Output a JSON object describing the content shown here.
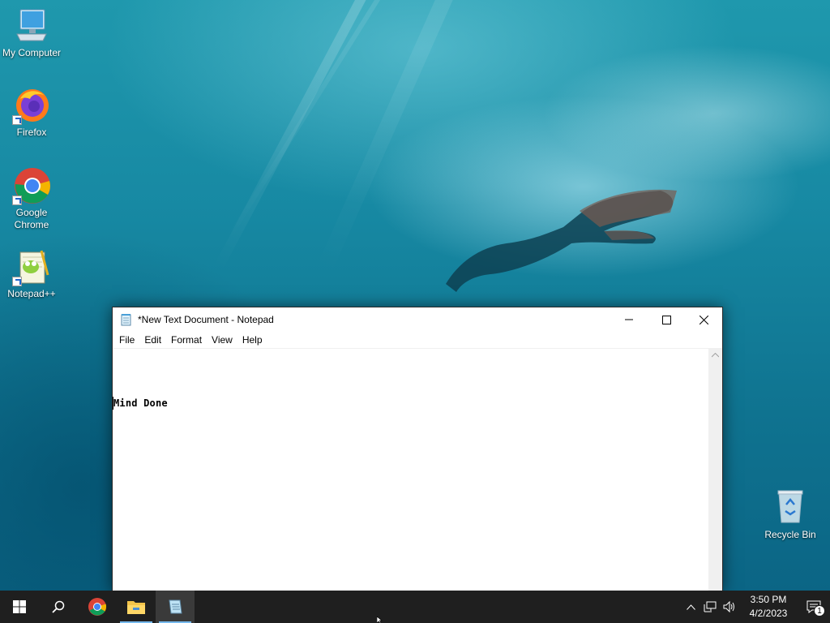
{
  "desktop": {
    "icons": [
      {
        "label": "My Computer",
        "icon": "computer-icon"
      },
      {
        "label": "Firefox",
        "icon": "firefox-icon"
      },
      {
        "label": "Google Chrome",
        "icon": "chrome-icon"
      },
      {
        "label": "Notepad++",
        "icon": "notepadpp-icon"
      }
    ],
    "recycle_bin": {
      "label": "Recycle Bin",
      "icon": "recycle-bin-icon"
    }
  },
  "notepad": {
    "title": "*New Text Document - Notepad",
    "menu": [
      "File",
      "Edit",
      "Format",
      "View",
      "Help"
    ],
    "content": "Mind Done"
  },
  "taskbar": {
    "pinned": [
      "start-icon",
      "search-icon",
      "chrome-icon",
      "file-explorer-icon",
      "notepad-icon"
    ],
    "active": "notepad-icon",
    "tray_icons": [
      "chevron-up-icon",
      "network-icon",
      "volume-icon"
    ],
    "time": "3:50 PM",
    "date": "4/2/2023",
    "notification_count": "1"
  },
  "colors": {
    "taskbar_bg": "#1f1f1f",
    "accent": "#76b9ed",
    "window_bg": "#ffffff"
  }
}
